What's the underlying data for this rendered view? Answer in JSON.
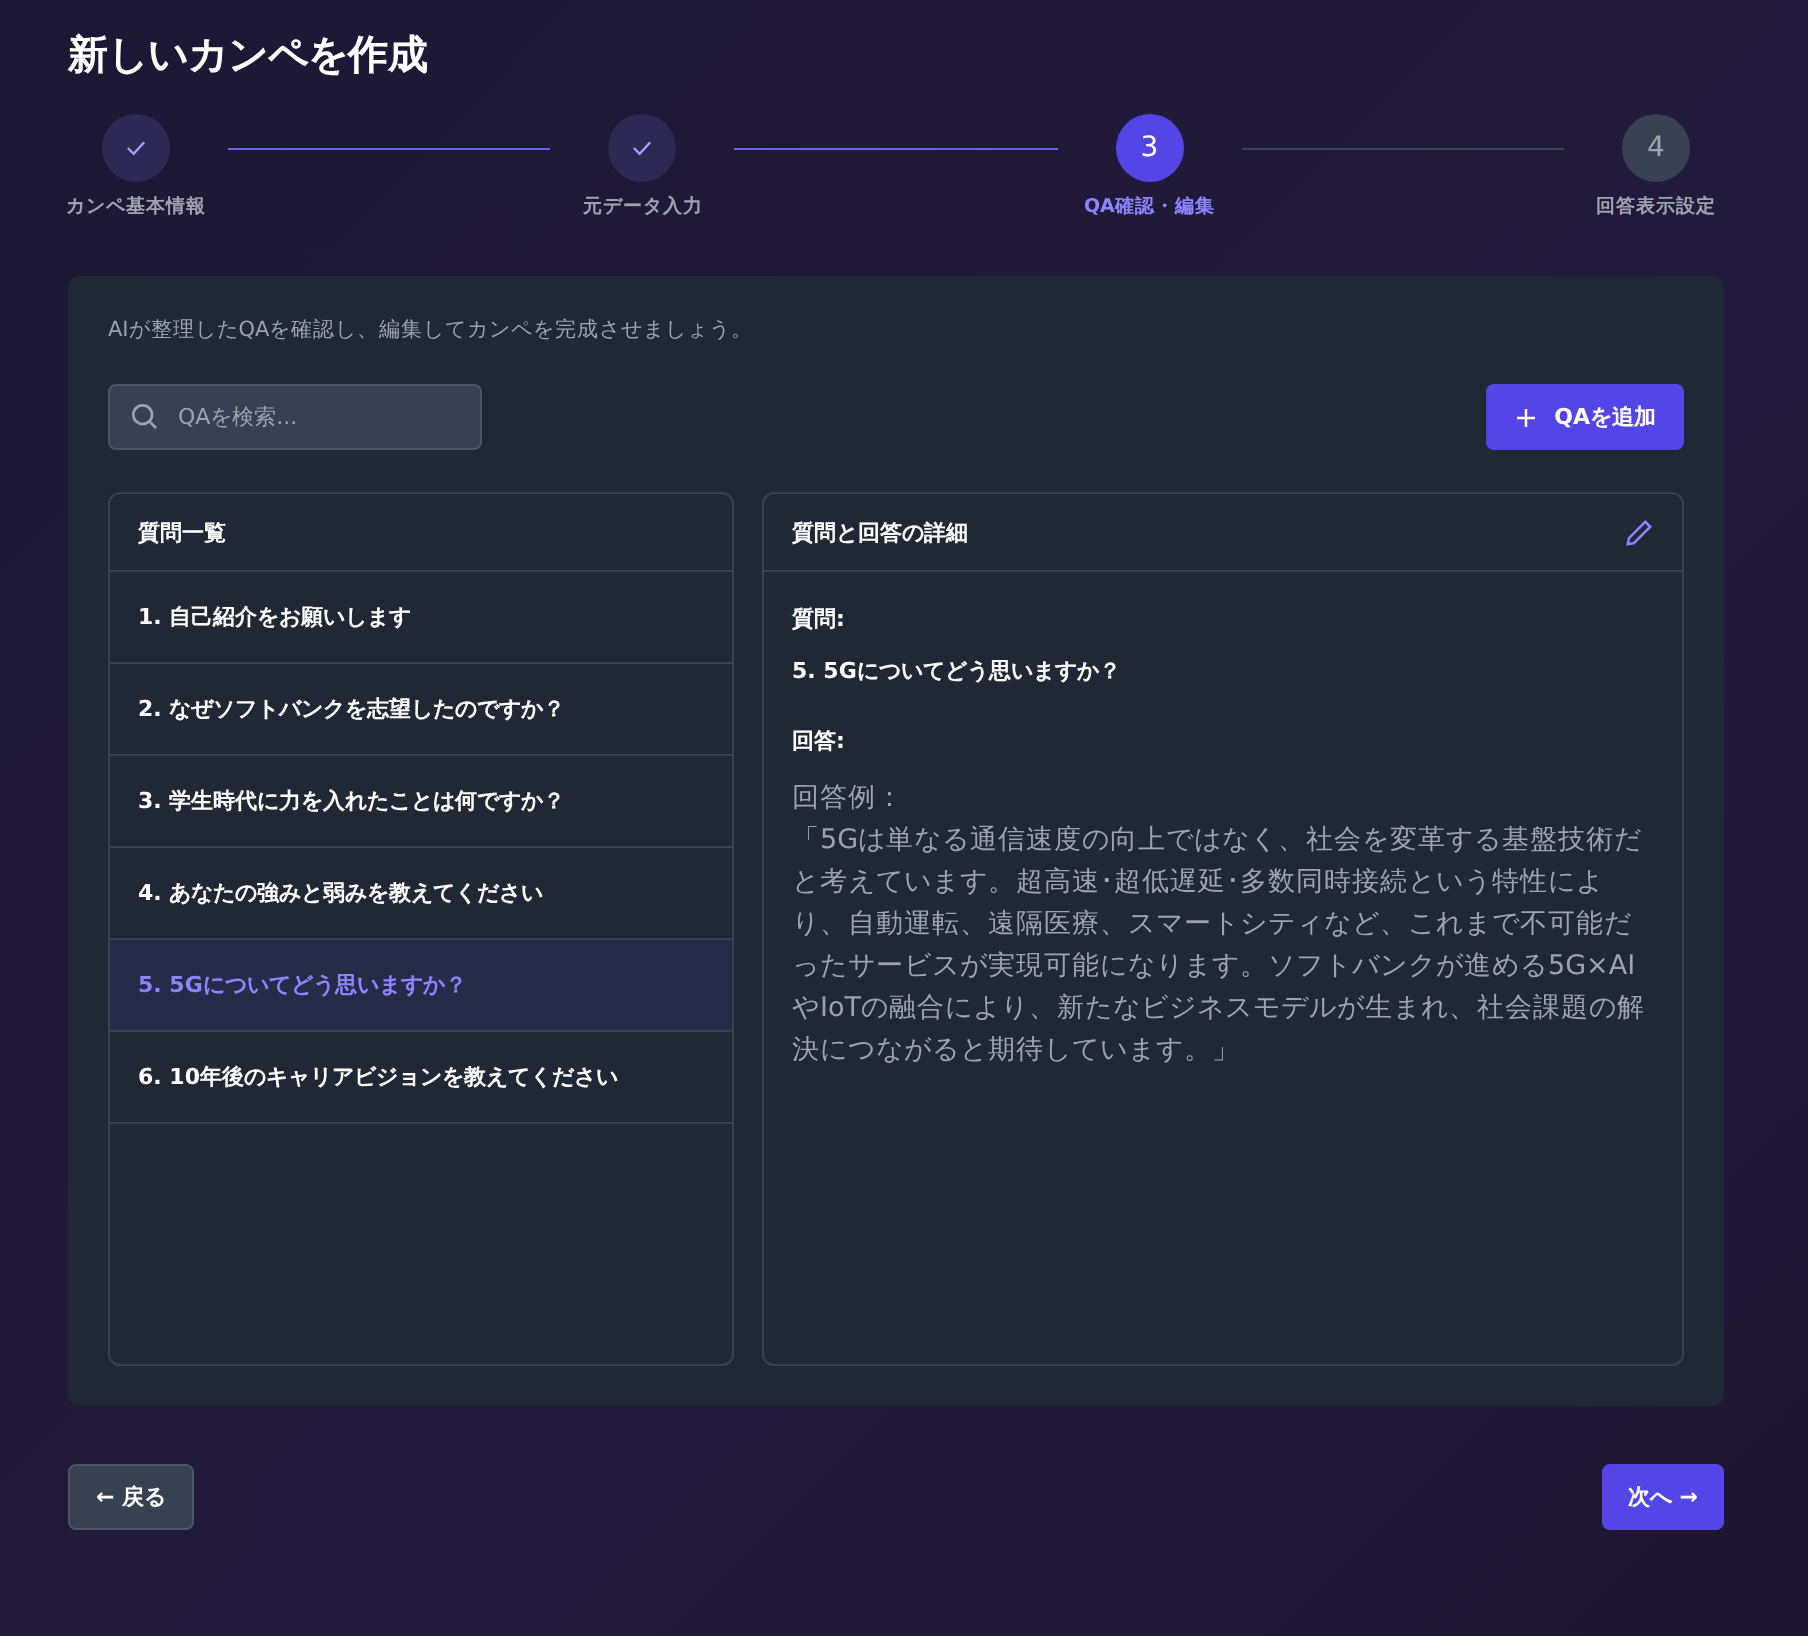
{
  "title": "新しいカンペを作成",
  "steps": [
    {
      "label": "カンペ基本情報",
      "kind": "done"
    },
    {
      "label": "元データ入力",
      "kind": "done"
    },
    {
      "label": "QA確認・編集",
      "number": "3",
      "kind": "current"
    },
    {
      "label": "回答表示設定",
      "number": "4",
      "kind": "pending"
    }
  ],
  "intro": "AIが整理したQAを確認し、編集してカンペを完成させましょう。",
  "search": {
    "placeholder": "QAを検索..."
  },
  "add_button": "QAを追加",
  "question_list": {
    "title": "質問一覧",
    "items": [
      {
        "text": "1. 自己紹介をお願いします",
        "selected": false
      },
      {
        "text": "2. なぜソフトバンクを志望したのですか？",
        "selected": false
      },
      {
        "text": "3. 学生時代に力を入れたことは何ですか？",
        "selected": false
      },
      {
        "text": "4. あなたの強みと弱みを教えてください",
        "selected": false
      },
      {
        "text": "5. 5Gについてどう思いますか？",
        "selected": true
      },
      {
        "text": "6. 10年後のキャリアビジョンを教えてください",
        "selected": false
      }
    ]
  },
  "detail": {
    "title": "質問と回答の詳細",
    "question_label": "質問:",
    "question": "5. 5Gについてどう思いますか？",
    "answer_label": "回答:",
    "answer_intro": "回答例：",
    "answer": "「5Gは単なる通信速度の向上ではなく、社会を変革する基盤技術だと考えています。超高速･超低遅延･多数同時接続という特性により、自動運転、遠隔医療、スマートシティなど、これまで不可能だったサービスが実現可能になります。ソフトバンクが進める5G×AIやIoTの融合により、新たなビジネスモデルが生まれ、社会課題の解決につながると期待しています。」"
  },
  "back_button": "← 戻る",
  "next_button": "次へ →"
}
